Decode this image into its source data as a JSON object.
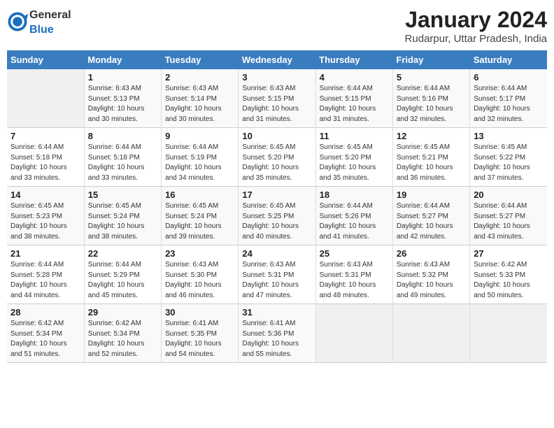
{
  "header": {
    "logo_general": "General",
    "logo_blue": "Blue",
    "month_year": "January 2024",
    "location": "Rudarpur, Uttar Pradesh, India"
  },
  "days_of_week": [
    "Sunday",
    "Monday",
    "Tuesday",
    "Wednesday",
    "Thursday",
    "Friday",
    "Saturday"
  ],
  "weeks": [
    [
      {
        "day": "",
        "empty": true
      },
      {
        "day": "1",
        "sunrise": "6:43 AM",
        "sunset": "5:13 PM",
        "daylight": "10 hours and 30 minutes."
      },
      {
        "day": "2",
        "sunrise": "6:43 AM",
        "sunset": "5:14 PM",
        "daylight": "10 hours and 30 minutes."
      },
      {
        "day": "3",
        "sunrise": "6:43 AM",
        "sunset": "5:15 PM",
        "daylight": "10 hours and 31 minutes."
      },
      {
        "day": "4",
        "sunrise": "6:44 AM",
        "sunset": "5:15 PM",
        "daylight": "10 hours and 31 minutes."
      },
      {
        "day": "5",
        "sunrise": "6:44 AM",
        "sunset": "5:16 PM",
        "daylight": "10 hours and 32 minutes."
      },
      {
        "day": "6",
        "sunrise": "6:44 AM",
        "sunset": "5:17 PM",
        "daylight": "10 hours and 32 minutes."
      }
    ],
    [
      {
        "day": "7",
        "sunrise": "6:44 AM",
        "sunset": "5:18 PM",
        "daylight": "10 hours and 33 minutes."
      },
      {
        "day": "8",
        "sunrise": "6:44 AM",
        "sunset": "5:18 PM",
        "daylight": "10 hours and 33 minutes."
      },
      {
        "day": "9",
        "sunrise": "6:44 AM",
        "sunset": "5:19 PM",
        "daylight": "10 hours and 34 minutes."
      },
      {
        "day": "10",
        "sunrise": "6:45 AM",
        "sunset": "5:20 PM",
        "daylight": "10 hours and 35 minutes."
      },
      {
        "day": "11",
        "sunrise": "6:45 AM",
        "sunset": "5:20 PM",
        "daylight": "10 hours and 35 minutes."
      },
      {
        "day": "12",
        "sunrise": "6:45 AM",
        "sunset": "5:21 PM",
        "daylight": "10 hours and 36 minutes."
      },
      {
        "day": "13",
        "sunrise": "6:45 AM",
        "sunset": "5:22 PM",
        "daylight": "10 hours and 37 minutes."
      }
    ],
    [
      {
        "day": "14",
        "sunrise": "6:45 AM",
        "sunset": "5:23 PM",
        "daylight": "10 hours and 38 minutes."
      },
      {
        "day": "15",
        "sunrise": "6:45 AM",
        "sunset": "5:24 PM",
        "daylight": "10 hours and 38 minutes."
      },
      {
        "day": "16",
        "sunrise": "6:45 AM",
        "sunset": "5:24 PM",
        "daylight": "10 hours and 39 minutes."
      },
      {
        "day": "17",
        "sunrise": "6:45 AM",
        "sunset": "5:25 PM",
        "daylight": "10 hours and 40 minutes."
      },
      {
        "day": "18",
        "sunrise": "6:44 AM",
        "sunset": "5:26 PM",
        "daylight": "10 hours and 41 minutes."
      },
      {
        "day": "19",
        "sunrise": "6:44 AM",
        "sunset": "5:27 PM",
        "daylight": "10 hours and 42 minutes."
      },
      {
        "day": "20",
        "sunrise": "6:44 AM",
        "sunset": "5:27 PM",
        "daylight": "10 hours and 43 minutes."
      }
    ],
    [
      {
        "day": "21",
        "sunrise": "6:44 AM",
        "sunset": "5:28 PM",
        "daylight": "10 hours and 44 minutes."
      },
      {
        "day": "22",
        "sunrise": "6:44 AM",
        "sunset": "5:29 PM",
        "daylight": "10 hours and 45 minutes."
      },
      {
        "day": "23",
        "sunrise": "6:43 AM",
        "sunset": "5:30 PM",
        "daylight": "10 hours and 46 minutes."
      },
      {
        "day": "24",
        "sunrise": "6:43 AM",
        "sunset": "5:31 PM",
        "daylight": "10 hours and 47 minutes."
      },
      {
        "day": "25",
        "sunrise": "6:43 AM",
        "sunset": "5:31 PM",
        "daylight": "10 hours and 48 minutes."
      },
      {
        "day": "26",
        "sunrise": "6:43 AM",
        "sunset": "5:32 PM",
        "daylight": "10 hours and 49 minutes."
      },
      {
        "day": "27",
        "sunrise": "6:42 AM",
        "sunset": "5:33 PM",
        "daylight": "10 hours and 50 minutes."
      }
    ],
    [
      {
        "day": "28",
        "sunrise": "6:42 AM",
        "sunset": "5:34 PM",
        "daylight": "10 hours and 51 minutes."
      },
      {
        "day": "29",
        "sunrise": "6:42 AM",
        "sunset": "5:34 PM",
        "daylight": "10 hours and 52 minutes."
      },
      {
        "day": "30",
        "sunrise": "6:41 AM",
        "sunset": "5:35 PM",
        "daylight": "10 hours and 54 minutes."
      },
      {
        "day": "31",
        "sunrise": "6:41 AM",
        "sunset": "5:36 PM",
        "daylight": "10 hours and 55 minutes."
      },
      {
        "day": "",
        "empty": true
      },
      {
        "day": "",
        "empty": true
      },
      {
        "day": "",
        "empty": true
      }
    ]
  ],
  "labels": {
    "sunrise_label": "Sunrise:",
    "sunset_label": "Sunset:",
    "daylight_label": "Daylight:"
  }
}
